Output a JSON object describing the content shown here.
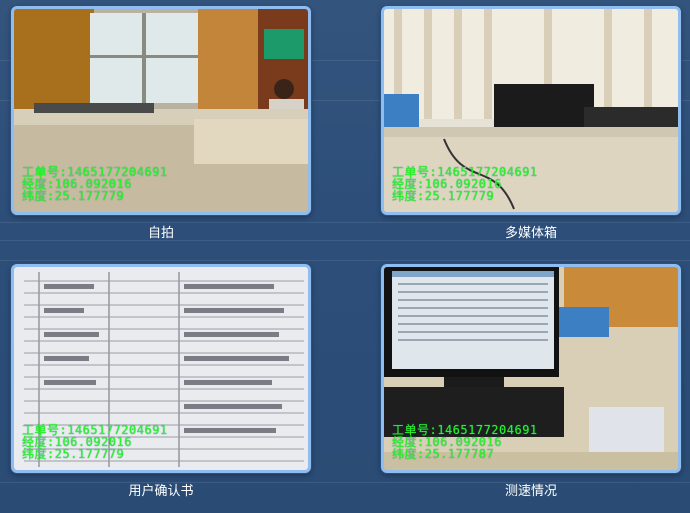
{
  "photos": [
    {
      "caption": "自拍",
      "stamp": {
        "order_line": "工单号:1465177204691",
        "lng_line": "经度:106.092016",
        "lat_line": "纬度:25.177779"
      },
      "scene": "selfie-office"
    },
    {
      "caption": "多媒体箱",
      "stamp": {
        "order_line": "工单号:1465177204691",
        "lng_line": "经度:106.092016",
        "lat_line": "纬度:25.177779"
      },
      "scene": "multimedia-box"
    },
    {
      "caption": "用户确认书",
      "stamp": {
        "order_line": "工单号:1465177204691",
        "lng_line": "经度:106.092016",
        "lat_line": "纬度:25.177779"
      },
      "scene": "confirmation-document"
    },
    {
      "caption": "测速情况",
      "stamp": {
        "order_line": "工单号:1465177204691",
        "lng_line": "经度:106.092016",
        "lat_line": "纬度:25.177787"
      },
      "scene": "speed-test-monitor"
    }
  ],
  "colors": {
    "frame": "#8fbdf0",
    "stamp": "#2cf22c",
    "background": "#2f5480"
  }
}
